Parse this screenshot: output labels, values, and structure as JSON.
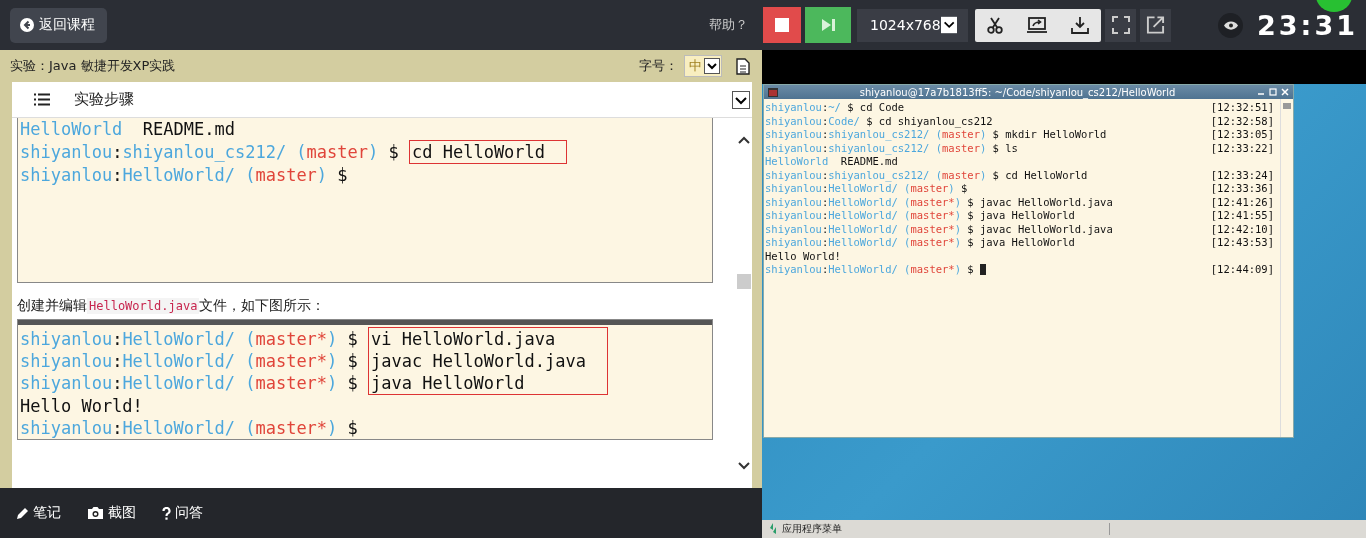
{
  "header": {
    "back_button": "返回课程",
    "help": "帮助？"
  },
  "toolbar": {
    "resolution": "1024x768",
    "timer": "23:31"
  },
  "lab": {
    "title": "实验：Java 敏捷开发XP实践",
    "font_size_label": "字号：",
    "font_size": "中",
    "section": "实验步骤"
  },
  "content": [
    {
      "kind": "screenshot",
      "titlebar": false,
      "lines": [
        {
          "segments": [
            {
              "kind": "prompt",
              "text": "HelloWorld"
            },
            {
              "kind": "plain",
              "text": "  README.md"
            }
          ]
        },
        {
          "segments": [
            {
              "kind": "prompt",
              "text": "shiyanlou"
            },
            {
              "kind": "plain",
              "text": ":"
            },
            {
              "kind": "prompt",
              "text": "shiyanlou_cs212/ ("
            },
            {
              "kind": "branch",
              "text": "master"
            },
            {
              "kind": "prompt",
              "text": ")"
            },
            {
              "kind": "plain",
              "text": " $ "
            }
          ],
          "command": "cd HelloWorld",
          "highlighted": true
        },
        {
          "segments": [
            {
              "kind": "prompt",
              "text": "shiyanlou"
            },
            {
              "kind": "plain",
              "text": ":"
            },
            {
              "kind": "prompt",
              "text": "HelloWorld/ ("
            },
            {
              "kind": "branch",
              "text": "master"
            },
            {
              "kind": "prompt",
              "text": ")"
            },
            {
              "kind": "plain",
              "text": " $"
            }
          ]
        }
      ]
    },
    {
      "kind": "paragraph",
      "parts": [
        {
          "kind": "text",
          "text": "创建并编辑"
        },
        {
          "kind": "code",
          "text": "HelloWorld.java"
        },
        {
          "kind": "text",
          "text": "文件，如下图所示："
        }
      ]
    },
    {
      "kind": "screenshot",
      "titlebar": true,
      "lines": [
        {
          "segments": [
            {
              "kind": "prompt",
              "text": "shiyanlou"
            },
            {
              "kind": "plain",
              "text": ":"
            },
            {
              "kind": "prompt",
              "text": "HelloWorld/ ("
            },
            {
              "kind": "branch",
              "text": "master*"
            },
            {
              "kind": "prompt",
              "text": ")"
            },
            {
              "kind": "plain",
              "text": " $ "
            }
          ],
          "command": "vi HelloWorld.java",
          "highlighted": true
        },
        {
          "segments": [
            {
              "kind": "prompt",
              "text": "shiyanlou"
            },
            {
              "kind": "plain",
              "text": ":"
            },
            {
              "kind": "prompt",
              "text": "HelloWorld/ ("
            },
            {
              "kind": "branch",
              "text": "master*"
            },
            {
              "kind": "prompt",
              "text": ")"
            },
            {
              "kind": "plain",
              "text": " $ "
            }
          ],
          "command": "javac HelloWorld.java",
          "highlighted": true
        },
        {
          "segments": [
            {
              "kind": "prompt",
              "text": "shiyanlou"
            },
            {
              "kind": "plain",
              "text": ":"
            },
            {
              "kind": "prompt",
              "text": "HelloWorld/ ("
            },
            {
              "kind": "branch",
              "text": "master*"
            },
            {
              "kind": "prompt",
              "text": ")"
            },
            {
              "kind": "plain",
              "text": " $ "
            }
          ],
          "command": "java HelloWorld",
          "highlighted": true
        },
        {
          "segments": [
            {
              "kind": "plain",
              "text": "Hello World!"
            }
          ]
        },
        {
          "segments": [
            {
              "kind": "prompt",
              "text": "shiyanlou"
            },
            {
              "kind": "plain",
              "text": ":"
            },
            {
              "kind": "prompt",
              "text": "HelloWorld/ ("
            },
            {
              "kind": "branch",
              "text": "master*"
            },
            {
              "kind": "prompt",
              "text": ")"
            },
            {
              "kind": "plain",
              "text": " $"
            }
          ]
        }
      ]
    }
  ],
  "bottom_bar": [
    {
      "kind": "pencil",
      "label": "笔记"
    },
    {
      "kind": "camera",
      "label": "截图"
    },
    {
      "kind": "question",
      "label": "问答"
    }
  ],
  "terminal": {
    "title": "shiyanlou@17a7b1813ff5: ~/Code/shiyanlou_cs212/HelloWorld",
    "lines": [
      {
        "segments": [
          {
            "kind": "prompt",
            "text": "shiyanlou"
          },
          {
            "kind": "plain",
            "text": ":"
          },
          {
            "kind": "prompt",
            "text": "~/"
          },
          {
            "kind": "plain",
            "text": " $ cd Code"
          }
        ],
        "time": "[12:32:51]",
        "cursor": false
      },
      {
        "segments": [
          {
            "kind": "prompt",
            "text": "shiyanlou"
          },
          {
            "kind": "plain",
            "text": ":"
          },
          {
            "kind": "prompt",
            "text": "Code/"
          },
          {
            "kind": "plain",
            "text": " $ cd shiyanlou_cs212"
          }
        ],
        "time": "[12:32:58]",
        "cursor": false
      },
      {
        "segments": [
          {
            "kind": "prompt",
            "text": "shiyanlou"
          },
          {
            "kind": "plain",
            "text": ":"
          },
          {
            "kind": "prompt",
            "text": "shiyanlou_cs212/ ("
          },
          {
            "kind": "branch",
            "text": "master"
          },
          {
            "kind": "prompt",
            "text": ")"
          },
          {
            "kind": "plain",
            "text": " $ mkdir HelloWorld"
          }
        ],
        "time": "[12:33:05]",
        "cursor": false
      },
      {
        "segments": [
          {
            "kind": "prompt",
            "text": "shiyanlou"
          },
          {
            "kind": "plain",
            "text": ":"
          },
          {
            "kind": "prompt",
            "text": "shiyanlou_cs212/ ("
          },
          {
            "kind": "branch",
            "text": "master"
          },
          {
            "kind": "prompt",
            "text": ")"
          },
          {
            "kind": "plain",
            "text": " $ ls"
          }
        ],
        "time": "[12:33:22]",
        "cursor": false
      },
      {
        "segments": [
          {
            "kind": "prompt",
            "text": "HelloWorld"
          },
          {
            "kind": "plain",
            "text": "  README.md"
          }
        ],
        "cursor": false
      },
      {
        "segments": [
          {
            "kind": "prompt",
            "text": "shiyanlou"
          },
          {
            "kind": "plain",
            "text": ":"
          },
          {
            "kind": "prompt",
            "text": "shiyanlou_cs212/ ("
          },
          {
            "kind": "branch",
            "text": "master"
          },
          {
            "kind": "prompt",
            "text": ")"
          },
          {
            "kind": "plain",
            "text": " $ cd HelloWorld"
          }
        ],
        "time": "[12:33:24]",
        "cursor": false
      },
      {
        "segments": [
          {
            "kind": "prompt",
            "text": "shiyanlou"
          },
          {
            "kind": "plain",
            "text": ":"
          },
          {
            "kind": "prompt",
            "text": "HelloWorld/ ("
          },
          {
            "kind": "branch",
            "text": "master"
          },
          {
            "kind": "prompt",
            "text": ")"
          },
          {
            "kind": "plain",
            "text": " $"
          }
        ],
        "time": "[12:33:36]",
        "cursor": false
      },
      {
        "segments": [
          {
            "kind": "prompt",
            "text": "shiyanlou"
          },
          {
            "kind": "plain",
            "text": ":"
          },
          {
            "kind": "prompt",
            "text": "HelloWorld/ ("
          },
          {
            "kind": "branch",
            "text": "master*"
          },
          {
            "kind": "prompt",
            "text": ")"
          },
          {
            "kind": "plain",
            "text": " $ javac HelloWorld.java"
          }
        ],
        "time": "[12:41:26]",
        "cursor": false
      },
      {
        "segments": [
          {
            "kind": "prompt",
            "text": "shiyanlou"
          },
          {
            "kind": "plain",
            "text": ":"
          },
          {
            "kind": "prompt",
            "text": "HelloWorld/ ("
          },
          {
            "kind": "branch",
            "text": "master*"
          },
          {
            "kind": "prompt",
            "text": ")"
          },
          {
            "kind": "plain",
            "text": " $ java HelloWorld"
          }
        ],
        "time": "[12:41:55]",
        "cursor": false
      },
      {
        "segments": [
          {
            "kind": "prompt",
            "text": "shiyanlou"
          },
          {
            "kind": "plain",
            "text": ":"
          },
          {
            "kind": "prompt",
            "text": "HelloWorld/ ("
          },
          {
            "kind": "branch",
            "text": "master*"
          },
          {
            "kind": "prompt",
            "text": ")"
          },
          {
            "kind": "plain",
            "text": " $ javac HelloWorld.java"
          }
        ],
        "time": "[12:42:10]",
        "cursor": false
      },
      {
        "segments": [
          {
            "kind": "prompt",
            "text": "shiyanlou"
          },
          {
            "kind": "plain",
            "text": ":"
          },
          {
            "kind": "prompt",
            "text": "HelloWorld/ ("
          },
          {
            "kind": "branch",
            "text": "master*"
          },
          {
            "kind": "prompt",
            "text": ")"
          },
          {
            "kind": "plain",
            "text": " $ java HelloWorld"
          }
        ],
        "time": "[12:43:53]",
        "cursor": false
      },
      {
        "segments": [
          {
            "kind": "plain",
            "text": "Hello World!"
          }
        ],
        "cursor": false
      },
      {
        "segments": [
          {
            "kind": "prompt",
            "text": "shiyanlou"
          },
          {
            "kind": "plain",
            "text": ":"
          },
          {
            "kind": "prompt",
            "text": "HelloWorld/ ("
          },
          {
            "kind": "branch",
            "text": "master*"
          },
          {
            "kind": "prompt",
            "text": ")"
          },
          {
            "kind": "plain",
            "text": " $ "
          }
        ],
        "time": "[12:44:09]",
        "cursor": true
      }
    ]
  },
  "taskbar": {
    "menu": "应用程序菜单"
  }
}
